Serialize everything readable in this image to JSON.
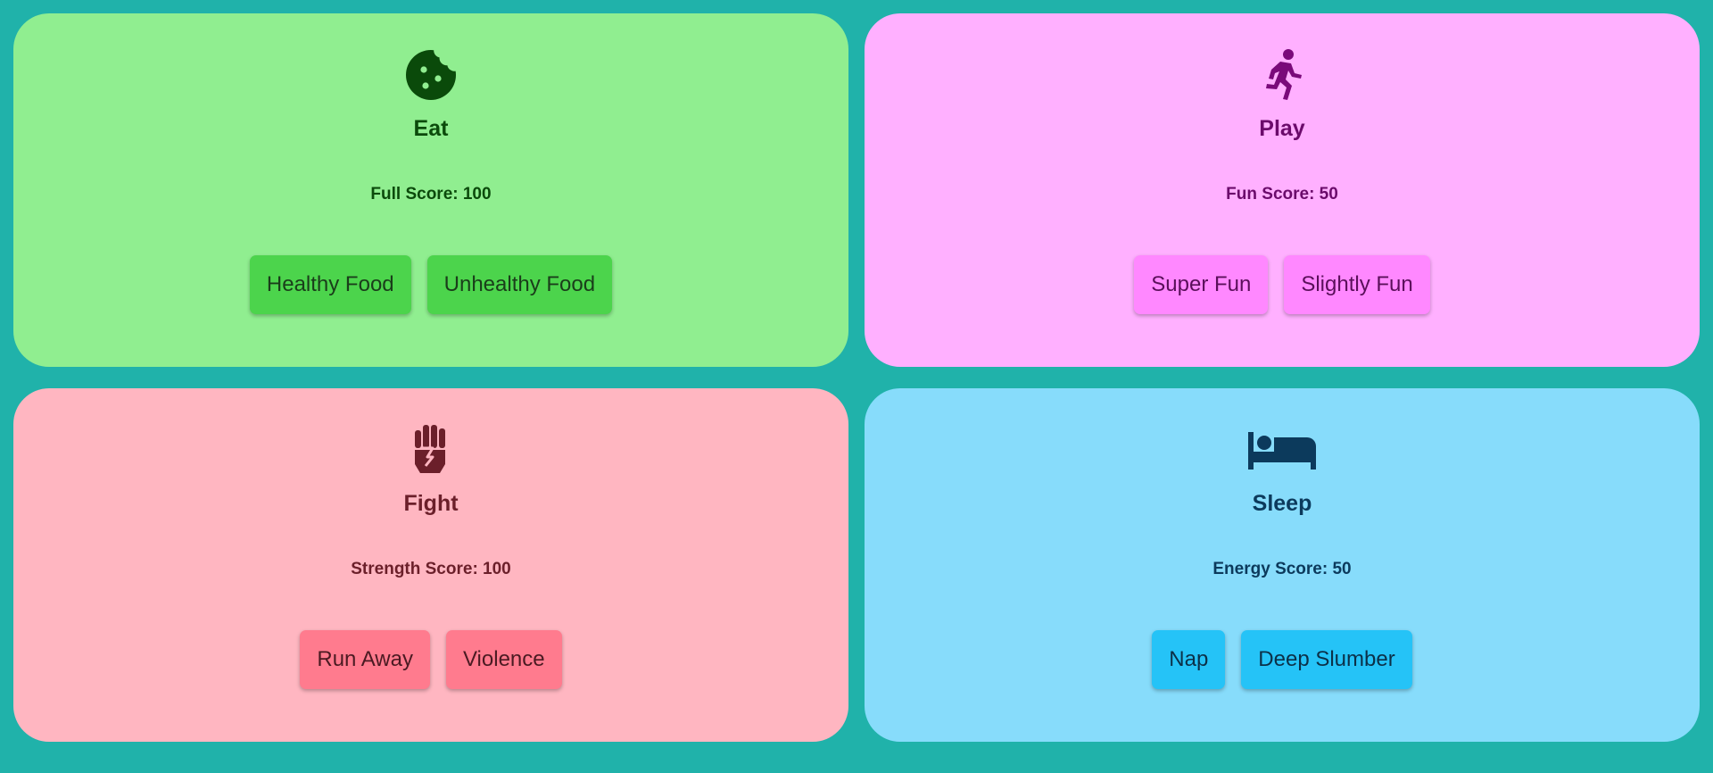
{
  "cards": {
    "eat": {
      "icon": "cookie-icon",
      "title": "Eat",
      "score": "Full Score: 100",
      "buttons": [
        "Healthy Food",
        "Unhealthy Food"
      ],
      "colors": {
        "background": "#90ee90",
        "accent": "#4cd44c",
        "text": "#0b4a0b"
      }
    },
    "play": {
      "icon": "running-icon",
      "title": "Play",
      "score": "Fun Score: 50",
      "buttons": [
        "Super Fun",
        "Slightly Fun"
      ],
      "colors": {
        "background": "#ffb0ff",
        "accent": "#ff88ff",
        "text": "#6b0b6b"
      }
    },
    "fight": {
      "icon": "fist-icon",
      "title": "Fight",
      "score": "Strength Score: 100",
      "buttons": [
        "Run Away",
        "Violence"
      ],
      "colors": {
        "background": "#ffb6c1",
        "accent": "#ff7b8e",
        "text": "#6b1f2a"
      }
    },
    "sleep": {
      "icon": "bed-icon",
      "title": "Sleep",
      "score": "Energy Score: 50",
      "buttons": [
        "Nap",
        "Deep Slumber"
      ],
      "colors": {
        "background": "#87dcfb",
        "accent": "#25c3f7",
        "text": "#0c3a5c"
      }
    }
  },
  "page": {
    "background": "#20b2aa"
  }
}
